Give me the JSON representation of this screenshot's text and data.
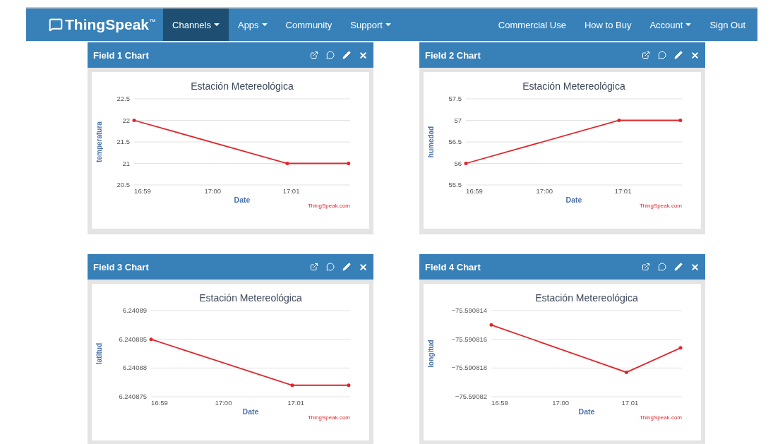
{
  "navbar": {
    "logo": "ThingSpeak",
    "logo_mark": "™",
    "left_items": [
      {
        "label": "Channels",
        "dropdown": true,
        "selected": true
      },
      {
        "label": "Apps",
        "dropdown": true,
        "selected": false
      },
      {
        "label": "Community",
        "dropdown": false,
        "selected": false
      },
      {
        "label": "Support",
        "dropdown": true,
        "selected": false
      }
    ],
    "right_items": [
      {
        "label": "Commercial Use",
        "dropdown": false,
        "selected": false
      },
      {
        "label": "How to Buy",
        "dropdown": false,
        "selected": false
      },
      {
        "label": "Account",
        "dropdown": true,
        "selected": false
      },
      {
        "label": "Sign Out",
        "dropdown": false,
        "selected": false
      }
    ]
  },
  "panels": [
    {
      "title": "Field 1 Chart",
      "credit": "ThingSpeak.com",
      "chart_data": {
        "type": "line",
        "title": "Estación Metereológica",
        "xlabel": "Date",
        "ylabel": "temperatura",
        "grid": true,
        "x": [
          1019,
          1020.95,
          1021.73
        ],
        "xlim": [
          1019,
          1021.75
        ],
        "xticks": [
          {
            "value": 1019,
            "label": "16:59"
          },
          {
            "value": 1020,
            "label": "17:00"
          },
          {
            "value": 1021,
            "label": "17:01"
          }
        ],
        "ylim": [
          20.5,
          22.5
        ],
        "yticks": [
          {
            "value": 20.5,
            "label": "20.5"
          },
          {
            "value": 21,
            "label": "21"
          },
          {
            "value": 21.5,
            "label": "21.5"
          },
          {
            "value": 22,
            "label": "22"
          },
          {
            "value": 22.5,
            "label": "22.5"
          }
        ],
        "series": [
          {
            "color": "#e0262b",
            "values": [
              22,
              21,
              21
            ]
          }
        ]
      }
    },
    {
      "title": "Field 2 Chart",
      "credit": "ThingSpeak.com",
      "chart_data": {
        "type": "line",
        "title": "Estación Metereológica",
        "xlabel": "Date",
        "ylabel": "humedad",
        "grid": true,
        "x": [
          1019,
          1020.95,
          1021.73
        ],
        "xlim": [
          1019,
          1021.75
        ],
        "xticks": [
          {
            "value": 1019,
            "label": "16:59"
          },
          {
            "value": 1020,
            "label": "17:00"
          },
          {
            "value": 1021,
            "label": "17:01"
          }
        ],
        "ylim": [
          55.5,
          57.5
        ],
        "yticks": [
          {
            "value": 55.5,
            "label": "55.5"
          },
          {
            "value": 56,
            "label": "56"
          },
          {
            "value": 56.5,
            "label": "56.5"
          },
          {
            "value": 57,
            "label": "57"
          },
          {
            "value": 57.5,
            "label": "57.5"
          }
        ],
        "series": [
          {
            "color": "#e0262b",
            "values": [
              56,
              57,
              57
            ]
          }
        ]
      }
    },
    {
      "title": "Field 3 Chart",
      "credit": "ThingSpeak.com",
      "chart_data": {
        "type": "line",
        "title": "Estación Metereológica",
        "xlabel": "Date",
        "ylabel": "latitud",
        "grid": true,
        "x": [
          1019,
          1020.95,
          1021.73
        ],
        "xlim": [
          1019,
          1021.75
        ],
        "xticks": [
          {
            "value": 1019,
            "label": "16:59"
          },
          {
            "value": 1020,
            "label": "17:00"
          },
          {
            "value": 1021,
            "label": "17:01"
          }
        ],
        "ylim": [
          6.240875,
          6.24089
        ],
        "yticks": [
          {
            "value": 6.240875,
            "label": "6.240875"
          },
          {
            "value": 6.24088,
            "label": "6.24088"
          },
          {
            "value": 6.240885,
            "label": "6.240885"
          },
          {
            "value": 6.24089,
            "label": "6.24089"
          }
        ],
        "series": [
          {
            "color": "#e0262b",
            "values": [
              6.240885,
              6.240877,
              6.240877
            ]
          }
        ]
      }
    },
    {
      "title": "Field 4 Chart",
      "credit": "ThingSpeak.com",
      "chart_data": {
        "type": "line",
        "title": "Estación Metereológica",
        "xlabel": "Date",
        "ylabel": "longitud",
        "grid": true,
        "x": [
          1019,
          1020.95,
          1021.73
        ],
        "xlim": [
          1019,
          1021.75
        ],
        "xticks": [
          {
            "value": 1019,
            "label": "16:59"
          },
          {
            "value": 1020,
            "label": "17:00"
          },
          {
            "value": 1021,
            "label": "17:01"
          }
        ],
        "ylim": [
          -75.59082,
          -75.590814
        ],
        "yticks": [
          {
            "value": -75.59082,
            "label": "−75.59082"
          },
          {
            "value": -75.590818,
            "label": "−75.590818"
          },
          {
            "value": -75.590816,
            "label": "−75.590816"
          },
          {
            "value": -75.590814,
            "label": "−75.590814"
          }
        ],
        "series": [
          {
            "color": "#e0262b",
            "values": [
              -75.590815,
              -75.5908183,
              -75.5908166
            ]
          }
        ]
      }
    }
  ]
}
